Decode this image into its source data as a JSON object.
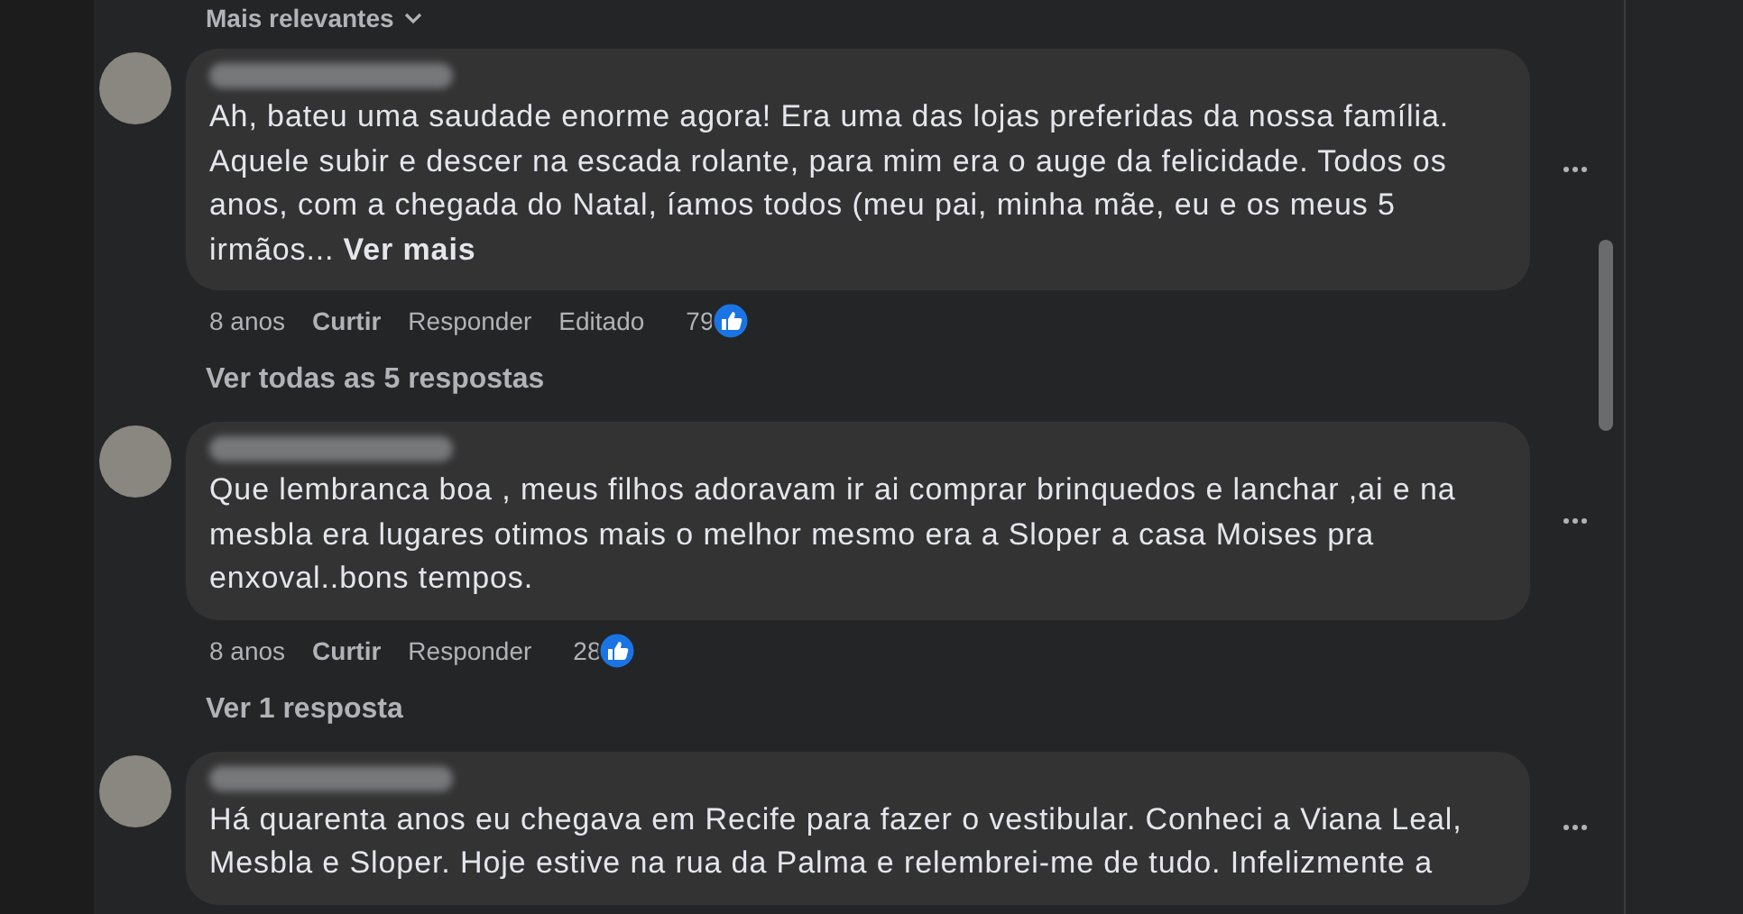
{
  "sort": {
    "label": "Mais relevantes"
  },
  "comments": [
    {
      "text": "Ah, bateu uma saudade enorme agora! Era uma das lojas preferidas da nossa família. Aquele subir e descer na escada rolante, para mim era o auge da felicidade. Todos os anos, com a chegada do Natal, íamos todos (meu pai, minha mãe, eu e os meus 5 irmãos...",
      "see_more": "Ver mais",
      "time": "8 anos",
      "like": "Curtir",
      "reply": "Responder",
      "edited": "Editado",
      "reactions": "79",
      "replies_link": "Ver todas as 5 respostas"
    },
    {
      "text": "Que lembranca boa , meus filhos adoravam ir ai comprar brinquedos e lanchar ,ai e na mesbla era lugares otimos mais o melhor mesmo era a Sloper a casa Moises pra enxoval..bons tempos.",
      "time": "8 anos",
      "like": "Curtir",
      "reply": "Responder",
      "reactions": "28",
      "replies_link": "Ver 1 resposta"
    },
    {
      "text": "Há quarenta anos eu chegava em Recife para fazer o vestibular. Conheci a Viana Leal, Mesbla e Sloper. Hoje estive na rua da Palma e relembrei-me de tudo. Infelizmente a"
    }
  ]
}
